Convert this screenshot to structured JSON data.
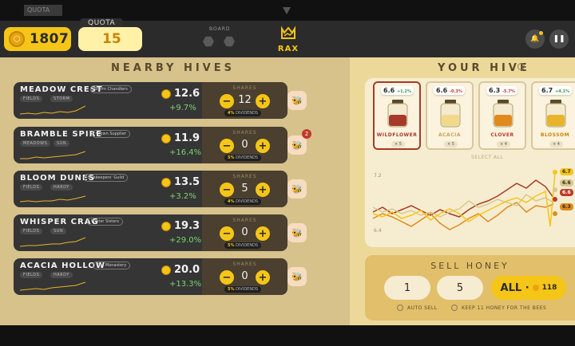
{
  "ghost": {
    "quota": "QUOTA"
  },
  "header": {
    "coins": "1807",
    "quota_label": "QUOTA",
    "quota_value": "15",
    "board_label": "BOARD",
    "logo_text": "RAX"
  },
  "nearby": {
    "title": "NEARBY HIVES",
    "shares_label": "SHARES",
    "hives": [
      {
        "name": "MEADOW CREST",
        "owner": "Storm Chandlers",
        "tags": [
          "FIELDS",
          "STORM"
        ],
        "price": "12.6",
        "change": "+9.7%",
        "shares": "12",
        "dividend": "4%",
        "dividend_suffix": "DIVIDENDS",
        "notifications": ""
      },
      {
        "name": "BRAMBLE SPIRE",
        "owner": "Crown Supplier",
        "tags": [
          "MEADOWS",
          "SUN"
        ],
        "price": "11.9",
        "change": "+16.4%",
        "shares": "0",
        "dividend": "5%",
        "dividend_suffix": "DIVIDENDS",
        "notifications": "2"
      },
      {
        "name": "BLOOM DUNES",
        "owner": "Beekeepers' Guild",
        "tags": [
          "FIELDS",
          "HARDY"
        ],
        "price": "13.5",
        "change": "+3.2%",
        "shares": "5",
        "dividend": "4%",
        "dividend_suffix": "DIVIDENDS",
        "notifications": ""
      },
      {
        "name": "WHISPER CRAG",
        "owner": "Winter Sisters",
        "tags": [
          "FIELDS",
          "SUN"
        ],
        "price": "19.3",
        "change": "+29.0%",
        "shares": "0",
        "dividend": "5%",
        "dividend_suffix": "DIVIDENDS",
        "notifications": ""
      },
      {
        "name": "ACACIA HOLLOW",
        "owner": "The Monastery",
        "tags": [
          "FIELDS",
          "HARDY"
        ],
        "price": "20.0",
        "change": "+13.3%",
        "shares": "0",
        "dividend": "5%",
        "dividend_suffix": "DIVIDENDS",
        "notifications": ""
      }
    ]
  },
  "your_hive": {
    "title": "YOUR HIVE",
    "select_all": "SELECT ALL",
    "honeys": [
      {
        "name": "WILDFLOWER",
        "price": "6.6",
        "change": "+1.2%",
        "count": "× 5",
        "color": "#a63a2a"
      },
      {
        "name": "ACACIA",
        "price": "6.6",
        "change": "-0.3%",
        "count": "× 5",
        "color": "#f2d98a"
      },
      {
        "name": "CLOVER",
        "price": "6.3",
        "change": "-5.7%",
        "count": "× 4",
        "color": "#e08a1e"
      },
      {
        "name": "BLOSSOM",
        "price": "6.7",
        "change": "+4.1%",
        "count": "× 4",
        "color": "#e8b52a"
      }
    ],
    "chart_data": {
      "type": "line",
      "yticks": [
        "7.2",
        "6.4"
      ],
      "end_labels": [
        {
          "value": "6.7",
          "color": "#f5c518"
        },
        {
          "value": "6.6",
          "color": "#d9c88a"
        },
        {
          "value": "6.6",
          "color": "#c0392b"
        },
        {
          "value": "6.3",
          "color": "#e08a1e"
        }
      ]
    }
  },
  "sell": {
    "title": "SELL HONEY",
    "options": [
      "1",
      "5"
    ],
    "all_label": "ALL ·",
    "all_amount": "118",
    "auto_sell": "AUTO SELL",
    "keep_label": "KEEP 11 HONEY FOR THE BEES"
  }
}
